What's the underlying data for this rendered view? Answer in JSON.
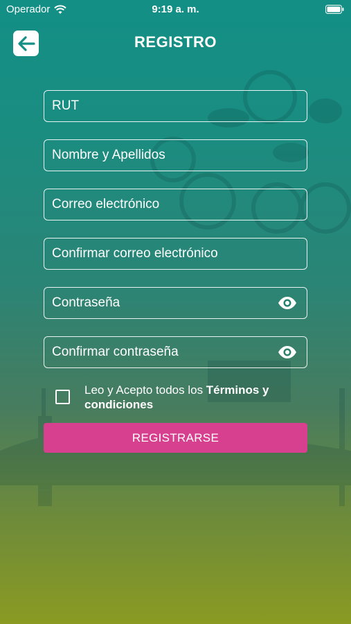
{
  "status_bar": {
    "carrier": "Operador",
    "time": "9:19 a. m."
  },
  "header": {
    "title": "REGISTRO",
    "back_icon": "arrow-left-icon"
  },
  "form": {
    "fields": [
      {
        "placeholder": "RUT"
      },
      {
        "placeholder": "Nombre y Apellidos"
      },
      {
        "placeholder": "Correo electrónico"
      },
      {
        "placeholder": "Confirmar correo electrónico"
      },
      {
        "placeholder": "Contraseña",
        "icon": "eye-icon"
      },
      {
        "placeholder": "Confirmar contraseña",
        "icon": "eye-icon"
      }
    ],
    "terms": {
      "prefix": "Leo y Acepto todos los ",
      "link": "Términos y condiciones"
    },
    "submit_label": "REGISTRARSE"
  },
  "colors": {
    "accent": "#138f86",
    "button": "#d7408f",
    "gradient_bottom": "#8a9a22"
  }
}
